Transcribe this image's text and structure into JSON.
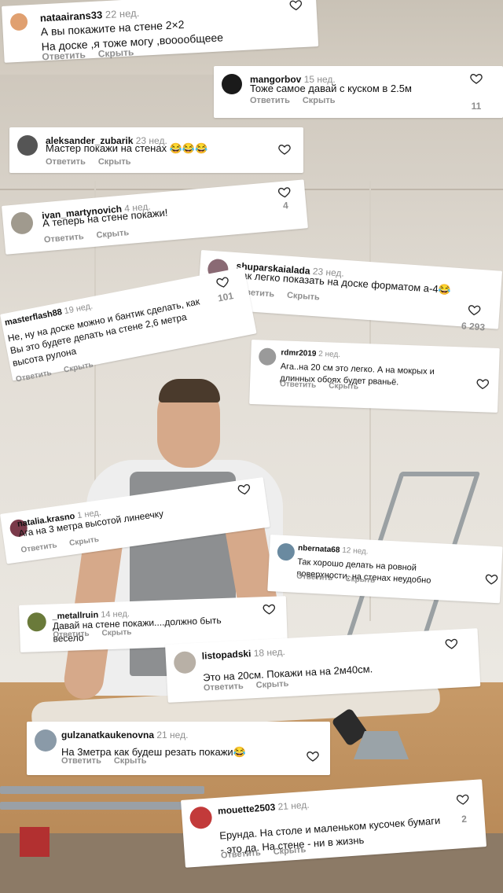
{
  "labels": {
    "reply": "Ответить",
    "hide": "Скрыть"
  },
  "comments": [
    {
      "user": "nataairans33",
      "ago": "22 нед.",
      "text": "А вы покажите на стене 2×2\nНа доске ,я тоже могу ,вооообщеее",
      "likes": "",
      "avatar_color": "#e0a070"
    },
    {
      "user": "mangorbov",
      "ago": "15 нед.",
      "text": "Тоже самое давай с куском в 2.5м",
      "likes": "11",
      "avatar_color": "#1a1a1a"
    },
    {
      "user": "aleksander_zubarik",
      "ago": "23 нед.",
      "text": "Мастер покажи на стенах 😂😂😂",
      "likes": "",
      "avatar_color": "#555555"
    },
    {
      "user": "ivan_martynovich",
      "ago": "4 нед.",
      "text": "А теперь на стене покажи!",
      "likes": "4",
      "avatar_color": "#a09a8e"
    },
    {
      "user": "shuparskaialada",
      "ago": "23 нед.",
      "text": "Как легко показать на доске форматом а-4😂",
      "likes": "6 293",
      "avatar_color": "#8a6a74"
    },
    {
      "user": "masterflash88",
      "ago": "19 нед.",
      "text": "Не, ну на доске можно и бантик сделать, как Вы это будете делать на стене 2,6 метра высота рулона",
      "likes": "101",
      "avatar_color": ""
    },
    {
      "user": "rdmr2019",
      "ago": "2 нед.",
      "text": "Ага..на 20 см это легко. А на мокрых и длинных обоях будет рваньё.",
      "likes": "",
      "avatar_color": "#9a9a9a"
    },
    {
      "user": "natalia.krasno",
      "ago": "1 нед.",
      "text": "Ага на 3 метра высотой линеечку",
      "likes": "",
      "avatar_color": "#7a3a4a"
    },
    {
      "user": "nbernata68",
      "ago": "12 нед.",
      "text": "Так хорошо делать на ровной поверхности,  на стенах неудобно",
      "likes": "",
      "avatar_color": "#6a8aa0"
    },
    {
      "user": "_metallruin",
      "ago": "14 нед.",
      "text": "Давай на стене покажи....должно быть весело",
      "likes": "",
      "avatar_color": "#6a7a3a"
    },
    {
      "user": "listopadski",
      "ago": "18 нед.",
      "text": "Это на 20см. Покажи на на 2м40см.",
      "likes": "",
      "avatar_color": "#b8b0a6"
    },
    {
      "user": "gulzanatkaukenovna",
      "ago": "21 нед.",
      "text": "На 3метра как будеш резать покажи😂",
      "likes": "",
      "avatar_color": "#8a9aa8"
    },
    {
      "user": "mouette2503",
      "ago": "21 нед.",
      "text": "Ерунда. На столе и маленьком кусочек бумаги - это да. На стене - ни в жизнь",
      "likes": "2",
      "avatar_color": "#c23a3a"
    }
  ],
  "colors": {
    "card_bg": "#ffffff",
    "text": "#111111",
    "muted": "#8e8e8e"
  },
  "icons": {
    "like": "heart-icon"
  }
}
